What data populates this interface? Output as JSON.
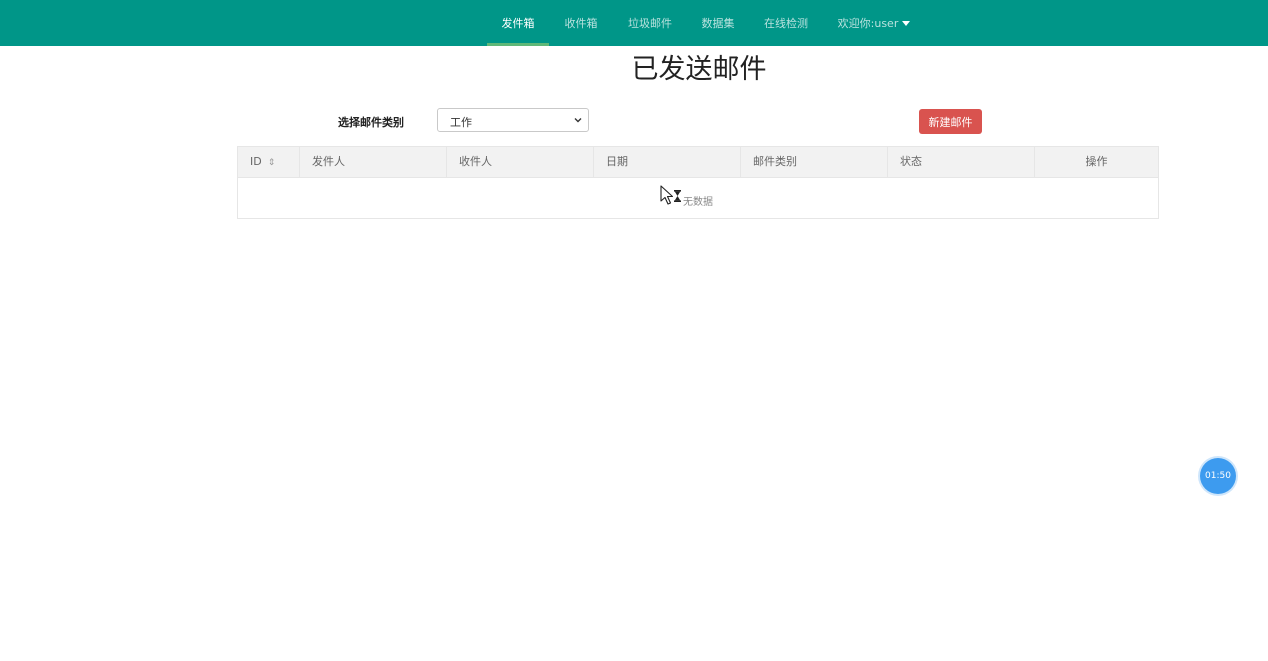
{
  "nav": {
    "items": [
      {
        "label": "发件箱",
        "active": true
      },
      {
        "label": "收件箱",
        "active": false
      },
      {
        "label": "垃圾邮件",
        "active": false
      },
      {
        "label": "数据集",
        "active": false
      },
      {
        "label": "在线检测",
        "active": false
      }
    ],
    "user_menu": "欢迎你:user",
    "colors": {
      "bar": "#009688",
      "active_underline": "#5fb878"
    }
  },
  "page": {
    "title": "已发送邮件"
  },
  "filter": {
    "label": "选择邮件类别",
    "selected": "工作"
  },
  "toolbar": {
    "new_label": "新建邮件",
    "color": "#d9534f"
  },
  "table": {
    "columns": [
      "ID",
      "发件人",
      "收件人",
      "日期",
      "邮件类别",
      "状态",
      "操作"
    ],
    "empty_text": "无数据",
    "rows": []
  },
  "timer": {
    "value": "01:50",
    "color": "#3d9bef"
  }
}
